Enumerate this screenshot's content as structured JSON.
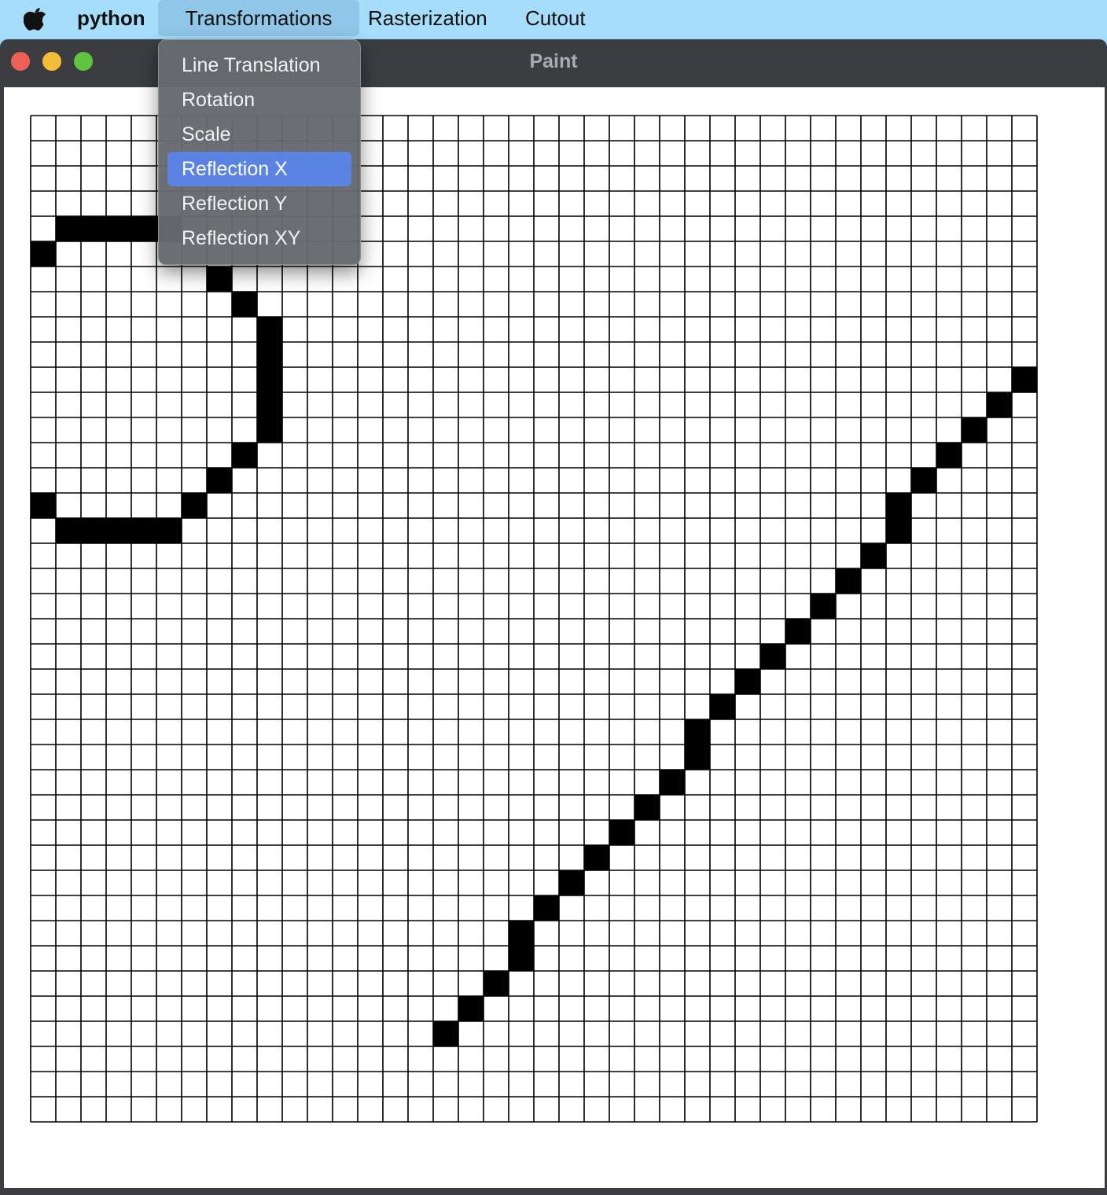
{
  "menubar": {
    "app_name": "python",
    "items": [
      {
        "label": "Transformations",
        "active": true
      },
      {
        "label": "Rasterization",
        "active": false
      },
      {
        "label": "Cutout",
        "active": false
      }
    ]
  },
  "window": {
    "title": "Paint",
    "traffic_lights": {
      "close": "#ed5f57",
      "minimize": "#f5bd37",
      "zoom": "#5fc440"
    }
  },
  "dropdown": {
    "items": [
      {
        "label": "Line Translation",
        "selected": false
      },
      {
        "label": "Rotation",
        "selected": false
      },
      {
        "label": "Scale",
        "selected": false
      },
      {
        "label": "Reflection X",
        "selected": true
      },
      {
        "label": "Reflection Y",
        "selected": false
      },
      {
        "label": "Reflection XY",
        "selected": false
      }
    ]
  },
  "grid": {
    "cols": 40,
    "rows": 40,
    "filled_cells": [
      [
        1,
        4
      ],
      [
        2,
        4
      ],
      [
        3,
        4
      ],
      [
        4,
        4
      ],
      [
        5,
        4
      ],
      [
        0,
        5
      ],
      [
        7,
        6
      ],
      [
        8,
        7
      ],
      [
        9,
        8
      ],
      [
        9,
        9
      ],
      [
        9,
        10
      ],
      [
        9,
        11
      ],
      [
        9,
        12
      ],
      [
        8,
        13
      ],
      [
        7,
        14
      ],
      [
        6,
        15
      ],
      [
        0,
        15
      ],
      [
        1,
        16
      ],
      [
        2,
        16
      ],
      [
        3,
        16
      ],
      [
        4,
        16
      ],
      [
        5,
        16
      ],
      [
        39,
        10
      ],
      [
        38,
        11
      ],
      [
        37,
        12
      ],
      [
        36,
        13
      ],
      [
        35,
        14
      ],
      [
        34,
        15
      ],
      [
        34,
        16
      ],
      [
        33,
        17
      ],
      [
        32,
        18
      ],
      [
        31,
        19
      ],
      [
        30,
        20
      ],
      [
        29,
        21
      ],
      [
        28,
        22
      ],
      [
        27,
        23
      ],
      [
        26,
        24
      ],
      [
        26,
        25
      ],
      [
        25,
        26
      ],
      [
        24,
        27
      ],
      [
        23,
        28
      ],
      [
        22,
        29
      ],
      [
        21,
        30
      ],
      [
        20,
        31
      ],
      [
        19,
        32
      ],
      [
        19,
        33
      ],
      [
        18,
        34
      ],
      [
        17,
        35
      ],
      [
        16,
        36
      ]
    ]
  }
}
